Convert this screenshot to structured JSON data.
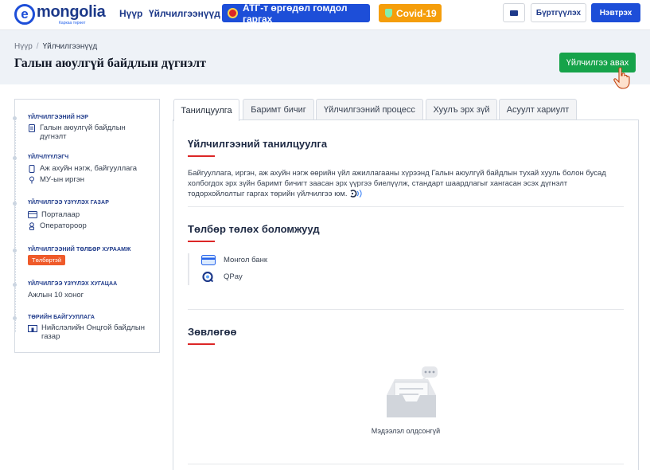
{
  "header": {
    "logo_letter": "e",
    "logo_word": "mongolia",
    "logo_tagline": "Каркаа төрөөт",
    "nav": [
      "Нүүр",
      "Үйлчилгээнүүд"
    ],
    "atg_button": "АТГ-т өргөдөл гомдол гаргах",
    "covid_button": "Covid-19",
    "register_button": "Бүртгүүлэх",
    "login_button": "Нэвтрэх",
    "brand_color": "#1d4ed8"
  },
  "breadcrumb": {
    "home": "Нүүр",
    "separator": "/",
    "current": "Үйлчилгээнүүд"
  },
  "page": {
    "title": "Галын аюулгүй байдлын дүгнэлт",
    "get_service_button": "Үйлчилгээ авах"
  },
  "sidebar": {
    "service_name": {
      "heading": "ҮЙЛЧИЛГЭЭНИЙ НЭР",
      "icon": "document-icon",
      "value_line1": "Галын аюулгүй байдлын",
      "value_line2": "дүгнэлт"
    },
    "recipient": {
      "heading": "ҮЙЛЧЛҮҮЛЭГЧ",
      "items": [
        {
          "icon": "phone-icon",
          "label": "Аж ахуйн нэгж, байгууллага"
        },
        {
          "icon": "user-icon",
          "label": "МУ-ын иргэн"
        }
      ]
    },
    "location": {
      "heading": "ҮЙЛЧИЛГЭЭ ҮЗҮҮЛЭХ ГАЗАР",
      "items": [
        {
          "icon": "monitor-icon",
          "label": "Порталаар"
        },
        {
          "icon": "operator-icon",
          "label": "Оператороор"
        }
      ]
    },
    "fee": {
      "heading": "ҮЙЛЧИЛГЭЭНИЙ ТӨЛБӨР ХУРААМЖ",
      "badge": "Төлбөртэй",
      "badge_color": "#ef5a2a"
    },
    "duration": {
      "heading": "ҮЙЛЧИЛГЭЭ ҮЗҮҮЛЭХ ХУГАЦАА",
      "value": "Ажлын 10 хоног"
    },
    "agency": {
      "heading": "ТӨРИЙН БАЙГУУЛЛАГА",
      "icon": "building-icon",
      "value_line1": "Нийслэлийн Онцгой байдлын",
      "value_line2": "газар"
    }
  },
  "tabs": [
    "Танилцуулга",
    "Баримт бичиг",
    "Үйлчилгээний процесс",
    "Хуулъ эрх зүй",
    "Асуулт хариулт"
  ],
  "intro": {
    "title": "Үйлчилгээний танилцуулга",
    "line1": "Байгууллага, иргэн, аж ахуйн нэгж өөрийн үйл ажиллагааны хүрээнд Галын аюулгүй байдлын тухай хууль болон бусад",
    "line2": "холбогдох эрх зүйн баримт бичигт заасан эрх үүргээ биелүүлж, стандарт шаардлагыг хангасан эсэх дүгнэлт",
    "line3": "тодорхойлолтыг гаргах төрийн үйлчилгээ юм."
  },
  "payment": {
    "title": "Төлбөр төлөх боломжууд",
    "options": [
      {
        "icon": "card-icon",
        "label": "Монгол банк"
      },
      {
        "icon": "qpay-icon",
        "label": "QPay"
      }
    ]
  },
  "advice": {
    "title": "Зөвлөгөө",
    "empty_text": "Мэдээлэл олдсонгүй"
  },
  "accent_color": "#dc2626"
}
